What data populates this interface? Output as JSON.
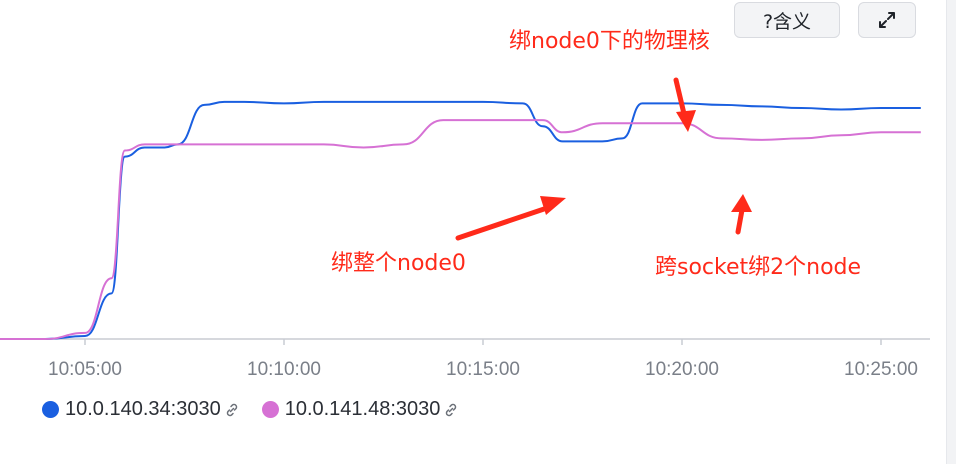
{
  "toolbar": {
    "meaning_label": "?含义",
    "expand_icon": "expand-icon"
  },
  "colors": {
    "series1": "#1a5fe0",
    "series2": "#d671d4",
    "annotation": "#ff2a1a"
  },
  "annotations": {
    "top": "绑node0下的物理核",
    "middle": "绑整个node0",
    "right": "跨socket绑2个node"
  },
  "chart_data": {
    "type": "line",
    "title": "",
    "xlabel": "",
    "ylabel": "",
    "x_ticks": [
      "10:05:00",
      "10:10:00",
      "10:15:00",
      "10:20:00",
      "10:25:00"
    ],
    "x": [
      "10:02:00",
      "10:04:00",
      "10:05:00",
      "10:05:40",
      "10:06:00",
      "10:06:30",
      "10:07:00",
      "10:07:20",
      "10:08:00",
      "10:08:30",
      "10:09:00",
      "10:10:00",
      "10:11:00",
      "10:12:00",
      "10:13:00",
      "10:14:00",
      "10:15:00",
      "10:16:00",
      "10:16:30",
      "10:17:00",
      "10:18:00",
      "10:18:30",
      "10:19:00",
      "10:20:00",
      "10:21:00",
      "10:22:00",
      "10:23:00",
      "10:24:00",
      "10:25:00",
      "10:26:00"
    ],
    "series": [
      {
        "name": "10.0.140.34:3030",
        "values": [
          0,
          0,
          1,
          15,
          60,
          63,
          63,
          64,
          77,
          78,
          78,
          77.5,
          78,
          78,
          78,
          78,
          78,
          77.5,
          70,
          65,
          65,
          66,
          77.5,
          77.5,
          77,
          76.5,
          76,
          75.5,
          76,
          76
        ]
      },
      {
        "name": "10.0.141.48:3030",
        "values": [
          0,
          0,
          2,
          20,
          62,
          64,
          64,
          64,
          64,
          64,
          64,
          64,
          64,
          63,
          64,
          72,
          72,
          72,
          72,
          68,
          71,
          71,
          71,
          71,
          66,
          65.5,
          66,
          67,
          68,
          68
        ]
      }
    ],
    "ylim": [
      0,
      100
    ],
    "grid": false,
    "legend_position": "bottom-left"
  }
}
